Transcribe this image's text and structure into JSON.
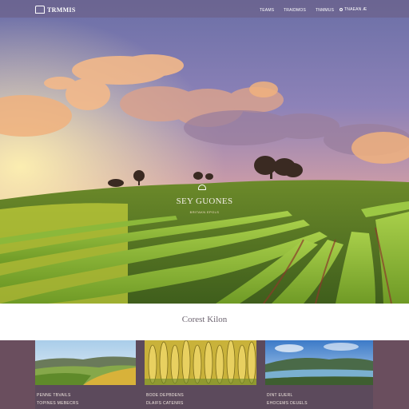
{
  "header": {
    "logo_text": "TRMMIS",
    "nav_items": [
      "TEAMS",
      "TRAIDMOS",
      "TNMMUS"
    ],
    "search_label": "TNAEAN Æ"
  },
  "hero": {
    "title": "SEY GUONES",
    "subtitle": "BRITAKN EPOLS"
  },
  "section": {
    "title": "Corest Kilon"
  },
  "cards": [
    {
      "line1": "PENNE TBVAILS",
      "line2": "TOPINES MEBECRS"
    },
    {
      "line1": "BODE DEPBDENS",
      "line2": "DLAIFS CATENRS"
    },
    {
      "line1": "DINT EUERL",
      "line2": "EHOCEMS DEUELS"
    }
  ],
  "colors": {
    "navbar": "#6c5c82",
    "band": "#5c4a5c",
    "field_green": "#7aa830",
    "sky_top": "#6c6fa8",
    "sunset": "#f2c070"
  }
}
